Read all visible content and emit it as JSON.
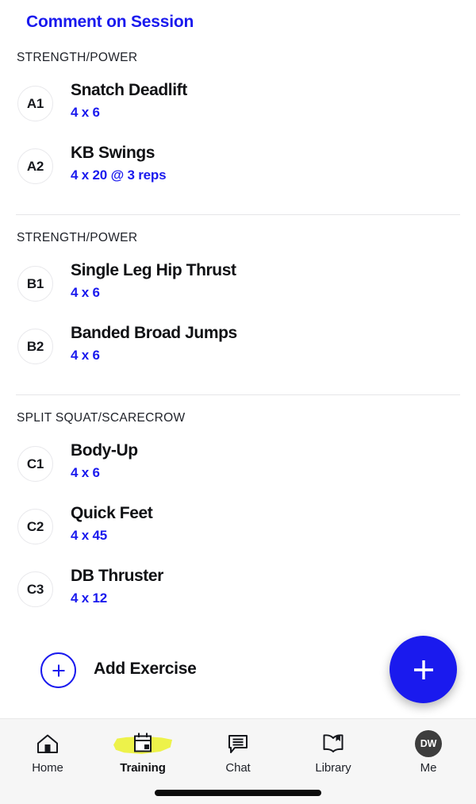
{
  "header": {
    "comment_link": "Comment on Session"
  },
  "sections": [
    {
      "title": "STRENGTH/POWER",
      "exercises": [
        {
          "badge": "A1",
          "name": "Snatch Deadlift",
          "scheme": "4 x 6"
        },
        {
          "badge": "A2",
          "name": "KB Swings",
          "scheme": "4 x 20 @ 3 reps"
        }
      ]
    },
    {
      "title": "STRENGTH/POWER",
      "exercises": [
        {
          "badge": "B1",
          "name": "Single Leg Hip Thrust",
          "scheme": "4 x 6"
        },
        {
          "badge": "B2",
          "name": "Banded Broad Jumps",
          "scheme": "4 x 6"
        }
      ]
    },
    {
      "title": "SPLIT SQUAT/SCARECROW",
      "exercises": [
        {
          "badge": "C1",
          "name": "Body-Up",
          "scheme": "4 x 6"
        },
        {
          "badge": "C2",
          "name": "Quick Feet",
          "scheme": "4 x 45"
        },
        {
          "badge": "C3",
          "name": "DB Thruster",
          "scheme": "4 x 12"
        }
      ]
    }
  ],
  "add_exercise": {
    "label": "Add Exercise",
    "icon": "plus-circle-icon"
  },
  "fab": {
    "icon": "plus-icon",
    "label": ""
  },
  "bottom_nav": {
    "items": [
      {
        "label": "Home",
        "icon": "home-icon",
        "active": false
      },
      {
        "label": "Training",
        "icon": "calendar-icon",
        "active": true
      },
      {
        "label": "Chat",
        "icon": "chat-bubble-icon",
        "active": false
      },
      {
        "label": "Library",
        "icon": "book-icon",
        "active": false
      },
      {
        "label": "Me",
        "icon": "avatar-icon",
        "active": false,
        "avatar_initials": "DW"
      }
    ]
  },
  "colors": {
    "accent_blue": "#1a1aee",
    "highlight_yellow": "#edf24a",
    "text_dark": "#101114",
    "divider": "#e6e6e8",
    "nav_background": "#f6f6f6",
    "avatar_background": "#3d3d3d"
  }
}
